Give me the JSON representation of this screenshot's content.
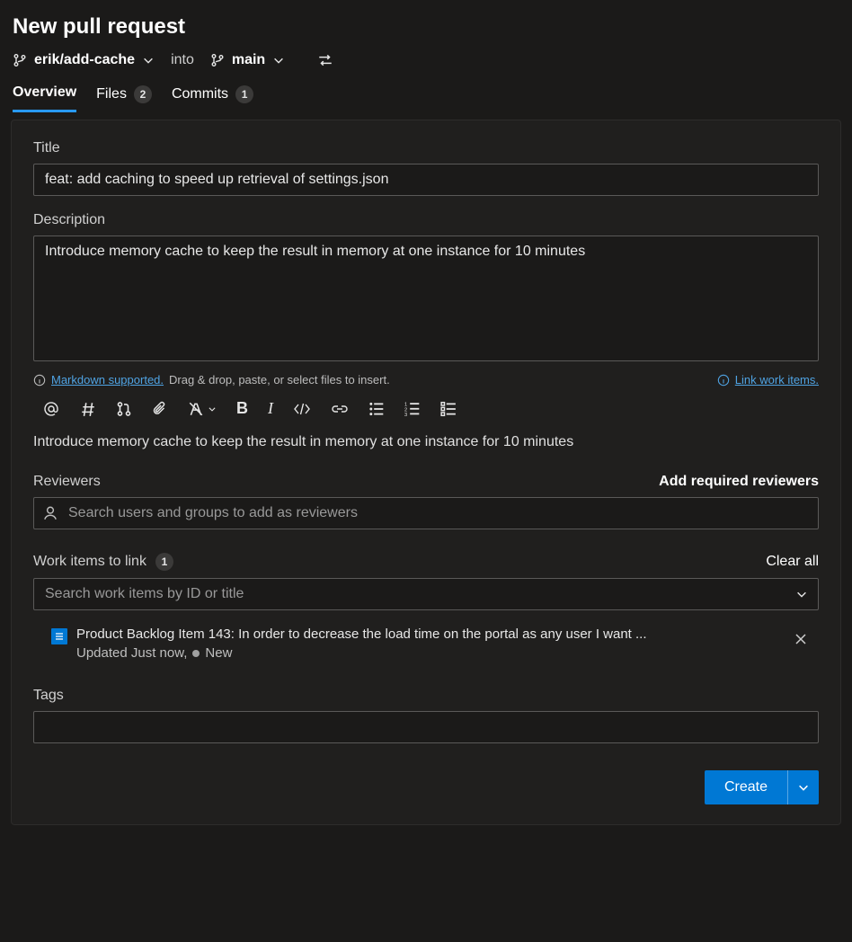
{
  "header": {
    "title": "New pull request",
    "source_branch": "erik/add-cache",
    "into_label": "into",
    "target_branch": "main"
  },
  "tabs": [
    {
      "label": "Overview",
      "active": true
    },
    {
      "label": "Files",
      "count": "2"
    },
    {
      "label": "Commits",
      "count": "1"
    }
  ],
  "form": {
    "title_label": "Title",
    "title_value": "feat: add caching to speed up retrieval of settings.json",
    "description_label": "Description",
    "description_value": "Introduce memory cache to keep the result in memory at one instance for 10 minutes",
    "markdown_link": "Markdown supported.",
    "upload_hint": "Drag & drop, paste, or select files to insert.",
    "link_work_items": "Link work items.",
    "preview_text": "Introduce memory cache to keep the result in memory at one instance for 10 minutes"
  },
  "reviewers": {
    "label": "Reviewers",
    "action": "Add required reviewers",
    "placeholder": "Search users and groups to add as reviewers"
  },
  "work_items": {
    "label": "Work items to link",
    "count": "1",
    "clear": "Clear all",
    "placeholder": "Search work items by ID or title",
    "item_title": "Product Backlog Item 143: In order to decrease the load time on the portal as any user I want ...",
    "item_sub_updated": "Updated Just now,",
    "item_state": "New"
  },
  "tags": {
    "label": "Tags"
  },
  "actions": {
    "create": "Create"
  }
}
